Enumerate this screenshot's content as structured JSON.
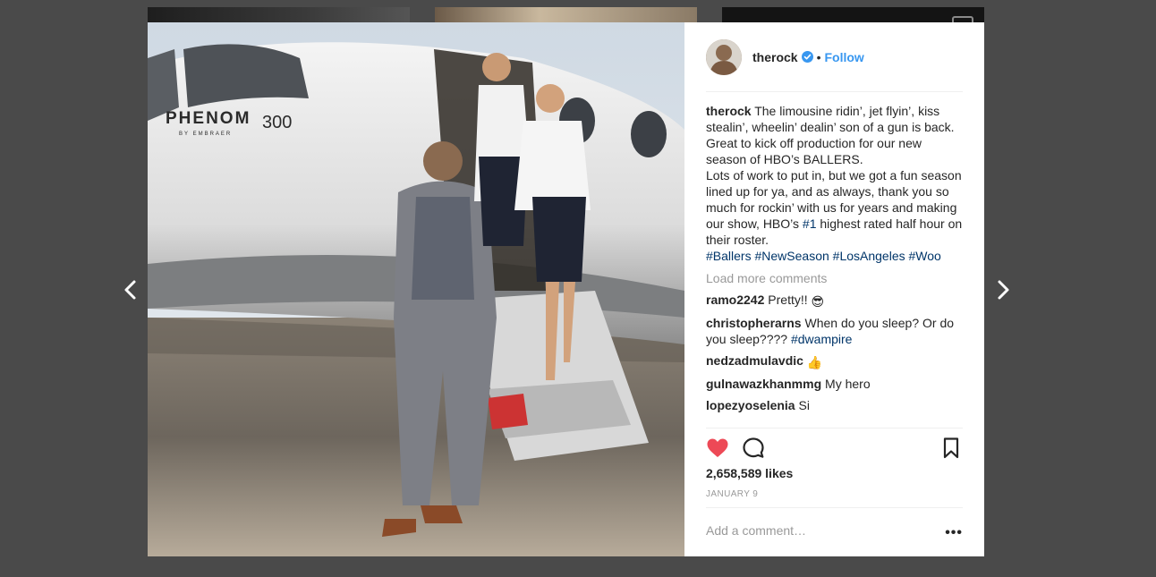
{
  "post": {
    "username": "therock",
    "follow_label": "Follow",
    "separator": "•",
    "caption": {
      "username": "therock",
      "line1": " The limousine ridin’, jet flyin’, kiss stealin’, wheelin’ dealin’ son of a gun is back.",
      "line2": "Great to kick off production for our new season of HBO’s BALLERS.",
      "line3a": "Lots of work to put in, but we got a fun season lined up for ya, and as always, thank you so much for rockin’ with us for years and making our show, HBO’s ",
      "line3_tag": "#1",
      "line3b": " highest rated half hour on their roster.",
      "hashtags": [
        "#Ballers",
        "#NewSeason",
        "#LosAngeles",
        "#Woo"
      ]
    },
    "load_more": "Load more comments",
    "comments": [
      {
        "user": "ramo2242",
        "text": " Pretty!! ",
        "emoji": "😎"
      },
      {
        "user": "christopherarns",
        "text": " When do you sleep? Or do you sleep???? ",
        "tag": "#dwampire"
      },
      {
        "user": "nedzadmulavdic",
        "text": " ",
        "emoji": "👍"
      },
      {
        "user": "gulnawazkhanmmg",
        "text": " My hero"
      },
      {
        "user": "lopezyoselenia",
        "text": " Si"
      }
    ],
    "likes": "2,658,589 likes",
    "date": "JANUARY 9",
    "add_comment_placeholder": "Add a comment…",
    "more_label": "•••",
    "image_text": {
      "brand": "PHENOM",
      "model": "300",
      "sub": "BY EMBRAER"
    }
  },
  "colors": {
    "accent": "#3897f0",
    "hashtag": "#003569",
    "like": "#ed4956",
    "backdrop": "#4a4a4a"
  },
  "icons": {
    "prev": "chevron-left-icon",
    "next": "chevron-right-icon",
    "like": "heart-icon",
    "comment": "speech-bubble-icon",
    "save": "bookmark-icon",
    "verified": "verified-badge-icon"
  }
}
